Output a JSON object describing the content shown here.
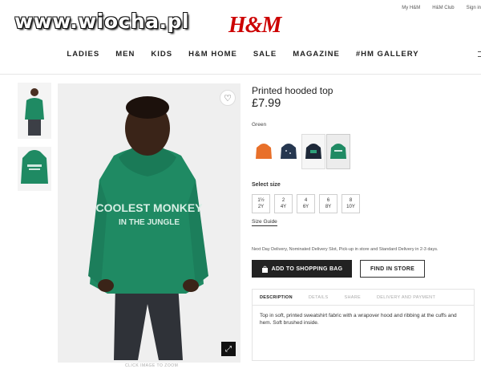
{
  "watermark": "www.wiocha.pl",
  "top_links": [
    "My H&M",
    "H&M Club",
    "Sign in"
  ],
  "logo": "H&M",
  "nav": [
    "LADIES",
    "MEN",
    "KIDS",
    "H&M HOME",
    "SALE",
    "MAGAZINE",
    "#HM GALLERY"
  ],
  "product": {
    "title": "Printed hooded top",
    "price": "£7.99",
    "print_text_line1": "COOLEST MONKEY",
    "print_text_line2": "IN THE JUNGLE"
  },
  "color": {
    "selected": "Green",
    "swatches": [
      {
        "name": "orange-hoodie",
        "color": "#e8702a"
      },
      {
        "name": "navy-hoodie",
        "color": "#263750"
      },
      {
        "name": "dark-hoodie",
        "color": "#1d2838"
      },
      {
        "name": "green-hoodie",
        "color": "#1f8a63"
      }
    ]
  },
  "sizes": {
    "label": "Select size",
    "options": [
      {
        "top": "1½",
        "bottom": "2Y"
      },
      {
        "top": "2",
        "bottom": "4Y"
      },
      {
        "top": "4",
        "bottom": "6Y"
      },
      {
        "top": "6",
        "bottom": "8Y"
      },
      {
        "top": "8",
        "bottom": "10Y"
      }
    ],
    "guide": "Size Guide"
  },
  "delivery": "Next Day Delivery, Nominated Delivery Slot, Pick-up in store and Standard Delivery in 2-3 days.",
  "buttons": {
    "add": "ADD TO SHOPPING BAG",
    "find": "FIND IN STORE"
  },
  "tabs": [
    "DESCRIPTION",
    "DETAILS",
    "SHARE",
    "DELIVERY AND PAYMENT"
  ],
  "description": "Top in soft, printed sweatshirt fabric with a wrapover hood and ribbing at the cuffs and hem. Soft brushed inside.",
  "image_caption": "CLICK IMAGE TO ZOOM",
  "colors": {
    "hoodie_green": "#1f8a63",
    "brand_red": "#cc0000"
  }
}
